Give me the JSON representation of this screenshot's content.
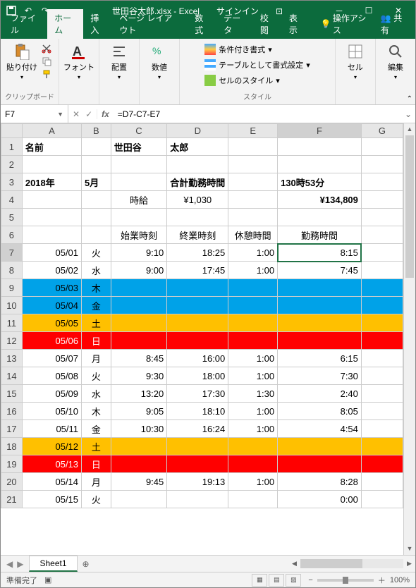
{
  "title": "世田谷太郎.xlsx - Excel",
  "signin": "サインイン",
  "tabs": {
    "file": "ファイル",
    "home": "ホーム",
    "insert": "挿入",
    "layout": "ページ レイアウト",
    "formulas": "数式",
    "data": "データ",
    "review": "校閲",
    "view": "表示",
    "tell": "操作アシス",
    "share": "共有"
  },
  "ribbon": {
    "clipboard": "クリップボード",
    "paste": "貼り付け",
    "font": "フォント",
    "align": "配置",
    "number": "数値",
    "styles": "スタイル",
    "cond": "条件付き書式",
    "table": "テーブルとして書式設定",
    "cellstyle": "セルのスタイル",
    "cells": "セル",
    "editing": "編集"
  },
  "namebox": "F7",
  "formula": "=D7-C7-E7",
  "sheet": "Sheet1",
  "status": "準備完了",
  "zoom": "100%",
  "cols": [
    "A",
    "B",
    "C",
    "D",
    "E",
    "F",
    "G"
  ],
  "rows": [
    {
      "n": 1,
      "cells": {
        "A": "名前",
        "C": "世田谷",
        "D": "太郎"
      },
      "bold": true,
      "left": true
    },
    {
      "n": 2,
      "cells": {}
    },
    {
      "n": 3,
      "cells": {
        "A": "2018年",
        "B": "5月",
        "D": "合計勤務時間",
        "F": "130時53分"
      },
      "bold": true,
      "left": true
    },
    {
      "n": 4,
      "cells": {
        "C": "時給",
        "D": "¥1,030",
        "F": "¥134,809"
      },
      "boldF": true,
      "center": [
        "C",
        "D"
      ]
    },
    {
      "n": 5,
      "cells": {}
    },
    {
      "n": 6,
      "cells": {
        "C": "始業時刻",
        "D": "終業時刻",
        "E": "休憩時間",
        "F": "勤務時間"
      },
      "center": [
        "C",
        "D",
        "E",
        "F"
      ],
      "border": true
    },
    {
      "n": 7,
      "cells": {
        "A": "05/01",
        "B": "火",
        "C": "9:10",
        "D": "18:25",
        "E": "1:00",
        "F": "8:15"
      },
      "border": true,
      "active": "F"
    },
    {
      "n": 8,
      "cells": {
        "A": "05/02",
        "B": "水",
        "C": "9:00",
        "D": "17:45",
        "E": "1:00",
        "F": "7:45"
      },
      "border": true
    },
    {
      "n": 9,
      "cells": {
        "A": "05/03",
        "B": "木"
      },
      "border": true,
      "class": "row-blue"
    },
    {
      "n": 10,
      "cells": {
        "A": "05/04",
        "B": "金"
      },
      "border": true,
      "class": "row-blue"
    },
    {
      "n": 11,
      "cells": {
        "A": "05/05",
        "B": "土"
      },
      "border": true,
      "class": "row-orange"
    },
    {
      "n": 12,
      "cells": {
        "A": "05/06",
        "B": "日"
      },
      "border": true,
      "class": "row-red"
    },
    {
      "n": 13,
      "cells": {
        "A": "05/07",
        "B": "月",
        "C": "8:45",
        "D": "16:00",
        "E": "1:00",
        "F": "6:15"
      },
      "border": true
    },
    {
      "n": 14,
      "cells": {
        "A": "05/08",
        "B": "火",
        "C": "9:30",
        "D": "18:00",
        "E": "1:00",
        "F": "7:30"
      },
      "border": true
    },
    {
      "n": 15,
      "cells": {
        "A": "05/09",
        "B": "水",
        "C": "13:20",
        "D": "17:30",
        "E": "1:30",
        "F": "2:40"
      },
      "border": true
    },
    {
      "n": 16,
      "cells": {
        "A": "05/10",
        "B": "木",
        "C": "9:05",
        "D": "18:10",
        "E": "1:00",
        "F": "8:05"
      },
      "border": true
    },
    {
      "n": 17,
      "cells": {
        "A": "05/11",
        "B": "金",
        "C": "10:30",
        "D": "16:24",
        "E": "1:00",
        "F": "4:54"
      },
      "border": true
    },
    {
      "n": 18,
      "cells": {
        "A": "05/12",
        "B": "土"
      },
      "border": true,
      "class": "row-orange"
    },
    {
      "n": 19,
      "cells": {
        "A": "05/13",
        "B": "日"
      },
      "border": true,
      "class": "row-red"
    },
    {
      "n": 20,
      "cells": {
        "A": "05/14",
        "B": "月",
        "C": "9:45",
        "D": "19:13",
        "E": "1:00",
        "F": "8:28"
      },
      "border": true
    },
    {
      "n": 21,
      "cells": {
        "A": "05/15",
        "B": "火",
        "F": "0:00"
      },
      "border": true
    }
  ]
}
